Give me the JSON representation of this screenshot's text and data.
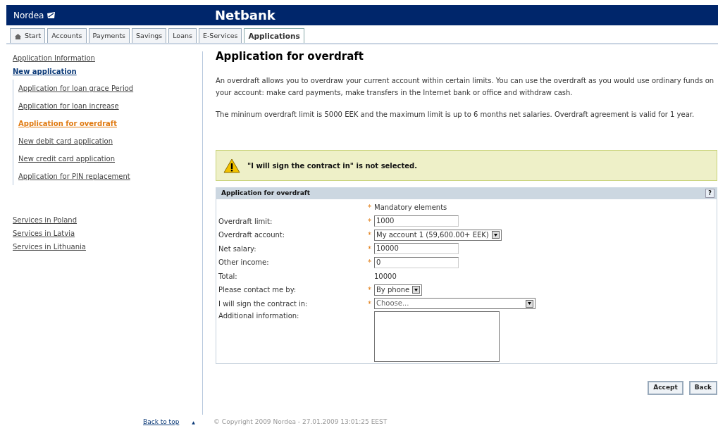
{
  "header": {
    "logo": "Nordea",
    "title": "Netbank"
  },
  "tabs": [
    {
      "label": "Start",
      "kind": "home",
      "selected": false
    },
    {
      "label": "Accounts",
      "kind": "text",
      "selected": false
    },
    {
      "label": "Payments",
      "kind": "text",
      "selected": false
    },
    {
      "label": "Savings",
      "kind": "text",
      "selected": false
    },
    {
      "label": "Loans",
      "kind": "text",
      "selected": false
    },
    {
      "label": "E-Services",
      "kind": "text",
      "selected": false
    },
    {
      "label": "Applications",
      "kind": "text",
      "selected": true
    }
  ],
  "sidebar": {
    "sections": [
      {
        "items": [
          {
            "label": "Application Information",
            "expanded": false
          },
          {
            "label": "New application",
            "expanded": true,
            "children": [
              {
                "label": "Application for loan grace Period",
                "selected": false
              },
              {
                "label": "Application for loan increase",
                "selected": false
              },
              {
                "label": "Application for overdraft",
                "selected": true
              },
              {
                "label": "New debit card application",
                "selected": false
              },
              {
                "label": "New credit card application",
                "selected": false
              },
              {
                "label": "Application for PIN replacement",
                "selected": false
              }
            ]
          }
        ]
      },
      {
        "items": [
          {
            "label": "Services in Poland",
            "expanded": false
          },
          {
            "label": "Services in Latvia",
            "expanded": false
          },
          {
            "label": "Services in Lithuania",
            "expanded": false
          }
        ]
      }
    ]
  },
  "page": {
    "title": "Application for overdraft",
    "paragraphs": [
      "An overdraft allows you to overdraw your current account within certain limits. You can use the overdraft as you would use ordinary funds on your account: make card payments, make transfers in the Internet bank or office and withdraw cash.",
      "The mininum overdraft limit is 5000 EEK and the maximum limit is up to 6 months net salaries. Overdraft agreement is valid for 1 year."
    ],
    "warning": "\"I will sign the contract in\" is not selected.",
    "form": {
      "title": "Application for overdraft",
      "help": "?",
      "required_mark": "*",
      "mandatory_note": "Mandatory elements",
      "rows": [
        {
          "label": "Overdraft limit:",
          "required": true,
          "kind": "input",
          "value": "1000"
        },
        {
          "label": "Overdraft account:",
          "required": true,
          "kind": "select",
          "value": "My account 1 (59,600.00+ EEK)"
        },
        {
          "label": "Net salary:",
          "required": true,
          "kind": "input",
          "value": "10000"
        },
        {
          "label": "Other income:",
          "required": true,
          "kind": "input",
          "value": "0"
        },
        {
          "label": "Total:",
          "required": false,
          "kind": "text",
          "value": "10000"
        },
        {
          "label": "Please contact me by:",
          "required": true,
          "kind": "select",
          "value": "By phone"
        },
        {
          "label": "I will sign the contract in:",
          "required": true,
          "kind": "wideselect",
          "value": "Choose..."
        },
        {
          "label": "Additional information:",
          "required": false,
          "kind": "textarea"
        }
      ]
    },
    "buttons": [
      "Accept",
      "Back"
    ]
  },
  "footer": {
    "back_to_top": "Back to top",
    "arrow": "▲",
    "copyright": "© Copyright 2009 Nordea - 27.01.2009 13:01:25 EEST"
  }
}
